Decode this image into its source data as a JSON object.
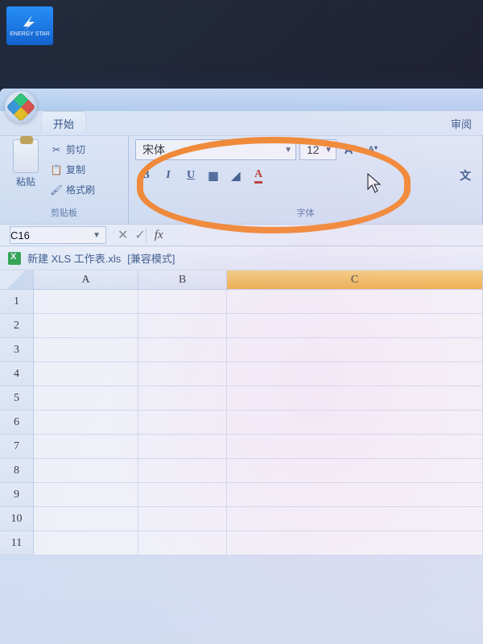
{
  "desktop_badge": {
    "label": "ENERGY STAR"
  },
  "ribbon_tabs": {
    "home": "开始",
    "review": "审阅"
  },
  "clipboard": {
    "paste": "粘贴",
    "cut": "剪切",
    "copy": "复制",
    "format_painter": "格式刷",
    "group_label": "剪贴板"
  },
  "font": {
    "family": "宋体",
    "size": "12",
    "group_label": "字体",
    "bold": "B",
    "italic": "I",
    "underline": "U",
    "grow": "A",
    "shrink": "A",
    "wen": "文"
  },
  "name_box": {
    "value": "C16"
  },
  "formula_bar": {
    "fx": "fx"
  },
  "document": {
    "filename": "新建 XLS 工作表.xls",
    "mode": "[兼容模式]"
  },
  "columns": [
    "A",
    "B",
    "C"
  ],
  "rows": [
    "1",
    "2",
    "3",
    "4",
    "5",
    "6",
    "7",
    "8",
    "9",
    "10",
    "11"
  ]
}
